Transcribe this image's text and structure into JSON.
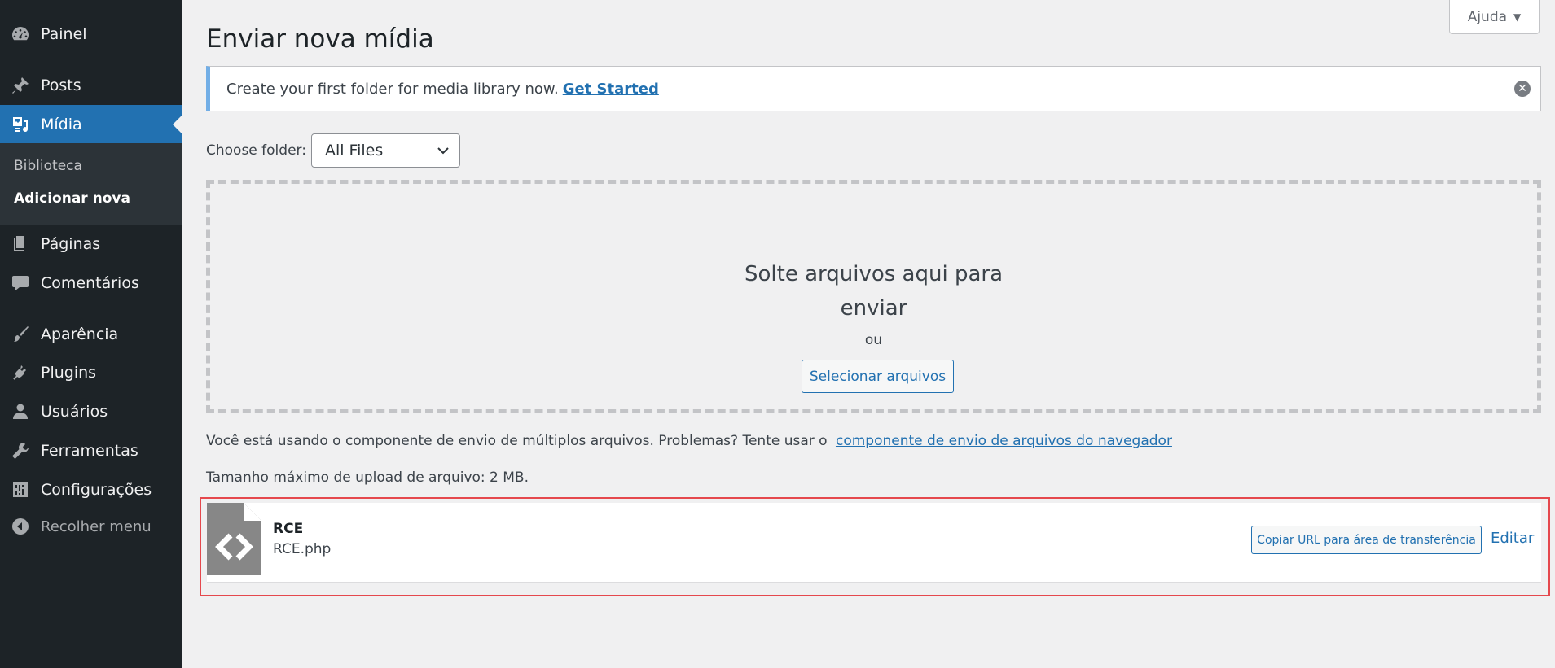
{
  "sidebar": {
    "items": [
      {
        "label": "Painel",
        "icon": "dashboard-icon"
      },
      {
        "label": "Posts",
        "icon": "pin-icon"
      },
      {
        "label": "Mídia",
        "icon": "media-icon"
      },
      {
        "label": "Páginas",
        "icon": "pages-icon"
      },
      {
        "label": "Comentários",
        "icon": "comments-icon"
      },
      {
        "label": "Aparência",
        "icon": "brush-icon"
      },
      {
        "label": "Plugins",
        "icon": "plugin-icon"
      },
      {
        "label": "Usuários",
        "icon": "user-icon"
      },
      {
        "label": "Ferramentas",
        "icon": "wrench-icon"
      },
      {
        "label": "Configurações",
        "icon": "settings-icon"
      }
    ],
    "active_item": "Mídia",
    "submenu": [
      {
        "label": "Biblioteca"
      },
      {
        "label": "Adicionar nova"
      }
    ],
    "collapse_label": "Recolher menu"
  },
  "header": {
    "help_label": "Ajuda",
    "page_title": "Enviar nova mídia"
  },
  "notice": {
    "text": "Create your first folder for media library now.",
    "link": "Get Started"
  },
  "folder": {
    "label": "Choose folder:",
    "selected": "All Files"
  },
  "dropzone": {
    "line1": "Solte arquivos aqui para",
    "line2": "enviar",
    "or": "ou",
    "button": "Selecionar arquivos"
  },
  "info": {
    "multi_text": "Você está usando o componente de envio de múltiplos arquivos. Problemas? Tente usar o",
    "multi_link": "componente de envio de arquivos do navegador",
    "max_size": "Tamanho máximo de upload de arquivo: 2 MB."
  },
  "upload": {
    "title": "RCE",
    "filename": "RCE.php",
    "copy_button": "Copiar URL para área de transferência",
    "edit_link": "Editar"
  },
  "colors": {
    "sidebar_bg": "#1d2327",
    "active": "#2271b1",
    "notice_border": "#72aee6",
    "highlight": "#e5484d"
  }
}
